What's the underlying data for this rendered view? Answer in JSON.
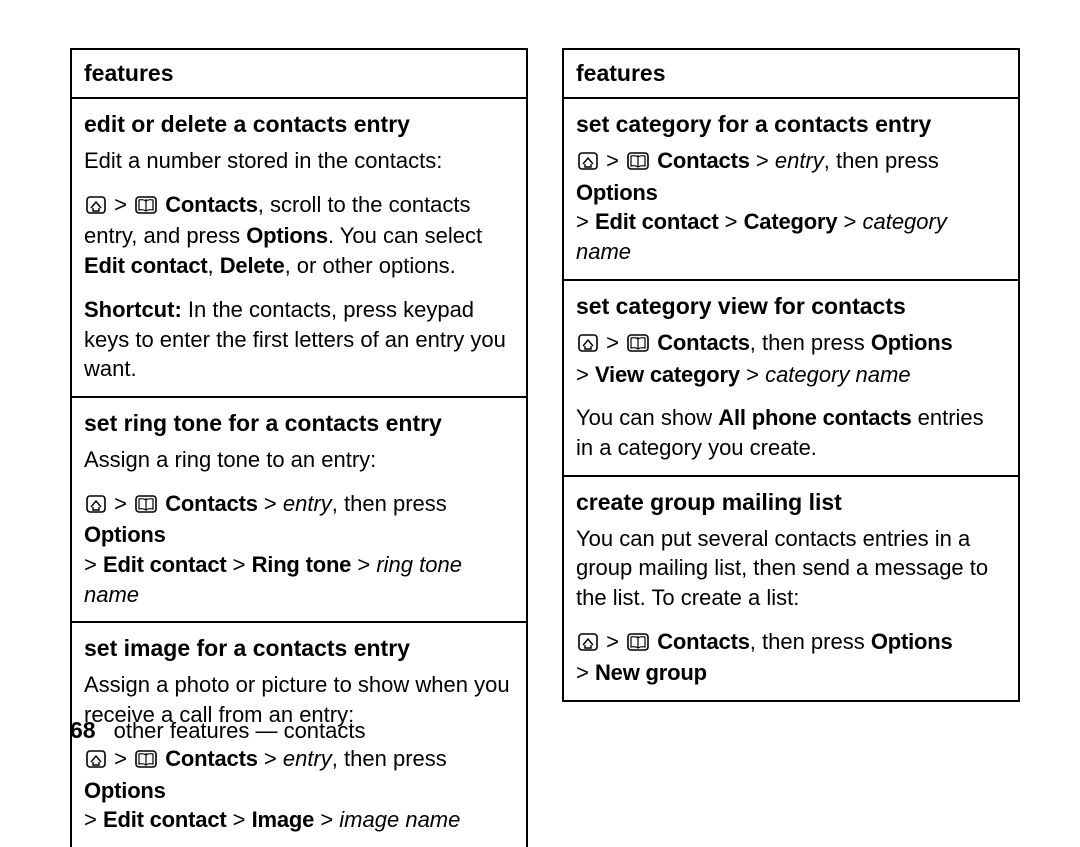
{
  "header": "features",
  "left": {
    "s1": {
      "title": "edit or delete a contacts entry",
      "intro": "Edit a number stored in the contacts:",
      "nav_contacts": "Contacts",
      "nav_tail": ", scroll to the contacts entry, and press ",
      "options": "Options",
      "nav_after": ". You can select ",
      "edit_contact": "Edit contact",
      "delete": "Delete",
      "nav_end": ", or other options.",
      "shortcut_label": "Shortcut:",
      "shortcut_text": " In the contacts, press keypad keys to enter the first letters of an entry you want."
    },
    "s2": {
      "title": "set ring tone for a contacts entry",
      "intro": "Assign a ring tone to an entry:",
      "contacts": "Contacts",
      "entry": "entry",
      "then_press": ", then press ",
      "options": "Options",
      "edit_contact": "Edit contact",
      "ringtone": "Ring tone",
      "ringtone_name": "ring tone name"
    },
    "s3": {
      "title": "set image for a contacts entry",
      "intro": "Assign a photo or picture to show when you receive a call from an entry:",
      "contacts": "Contacts",
      "entry": "entry",
      "then_press": ", then press ",
      "options": "Options",
      "edit_contact": "Edit contact",
      "image": "Image",
      "image_name": "image name"
    }
  },
  "right": {
    "s1": {
      "title": "set category for a contacts entry",
      "contacts": "Contacts",
      "entry": "entry",
      "then_press": ", then press ",
      "options": "Options",
      "edit_contact": "Edit contact",
      "category": "Category",
      "category_name": "category name"
    },
    "s2": {
      "title": "set category view for contacts",
      "contacts": "Contacts",
      "then_press": ", then press ",
      "options": "Options",
      "view_category": "View category",
      "category_name": "category name",
      "body1": "You can show ",
      "all_phone": "All phone contacts",
      "body2": " entries in a category you create."
    },
    "s3": {
      "title": "create group mailing list",
      "body": "You can put several contacts entries in a group mailing list, then send a message to the list. To create a list:",
      "contacts": "Contacts",
      "then_press": ", then press ",
      "options": "Options",
      "new_group": "New group"
    }
  },
  "footer": {
    "page": "68",
    "text": "other features — contacts"
  },
  "gt": ">"
}
